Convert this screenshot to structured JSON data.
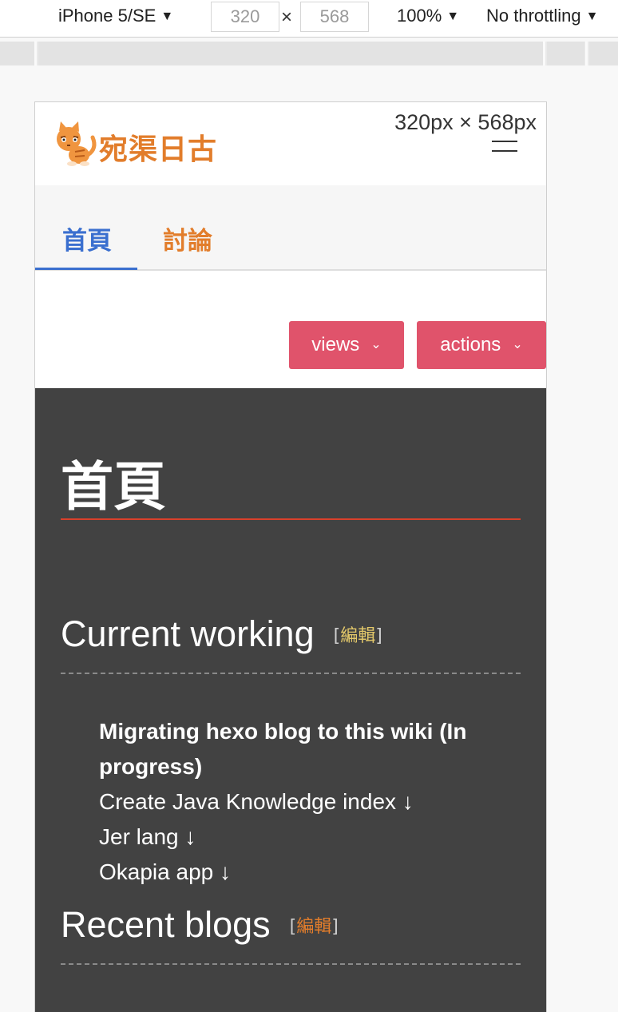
{
  "devtools": {
    "device_name": "iPhone 5/SE",
    "width_value": "320",
    "times": "×",
    "height_value": "568",
    "zoom": "100%",
    "throttling": "No throttling",
    "dropdown_glyph": "▼"
  },
  "site": {
    "logo_text": "宛渠日古",
    "viewport_label": "320px × 568px",
    "tabs": [
      {
        "label": "首頁",
        "active": true
      },
      {
        "label": "討論",
        "active": false
      }
    ],
    "buttons": {
      "views_label": "views",
      "actions_label": "actions",
      "chevron_glyph": "⌄"
    }
  },
  "content": {
    "page_title": "首頁",
    "sections": [
      {
        "heading": "Current working",
        "edit_open": "[",
        "edit_label": "編輯",
        "edit_close": "]"
      },
      {
        "heading": "Recent blogs",
        "edit_open": "[",
        "edit_label": "編輯",
        "edit_close": "]"
      }
    ],
    "working_items": [
      {
        "text": "Migrating hexo blog to this wiki (In progress)",
        "bold": true
      },
      {
        "text": "Create Java Knowledge index ↓",
        "bold": false
      },
      {
        "text": "Jer lang ↓",
        "bold": false
      },
      {
        "text": "Okapia app ↓",
        "bold": false
      }
    ]
  },
  "colors": {
    "accent_blue": "#3a6fcf",
    "accent_orange": "#e27d2b",
    "button_red": "#e0536b",
    "content_bg": "#424242",
    "title_rule": "#d9402b"
  }
}
